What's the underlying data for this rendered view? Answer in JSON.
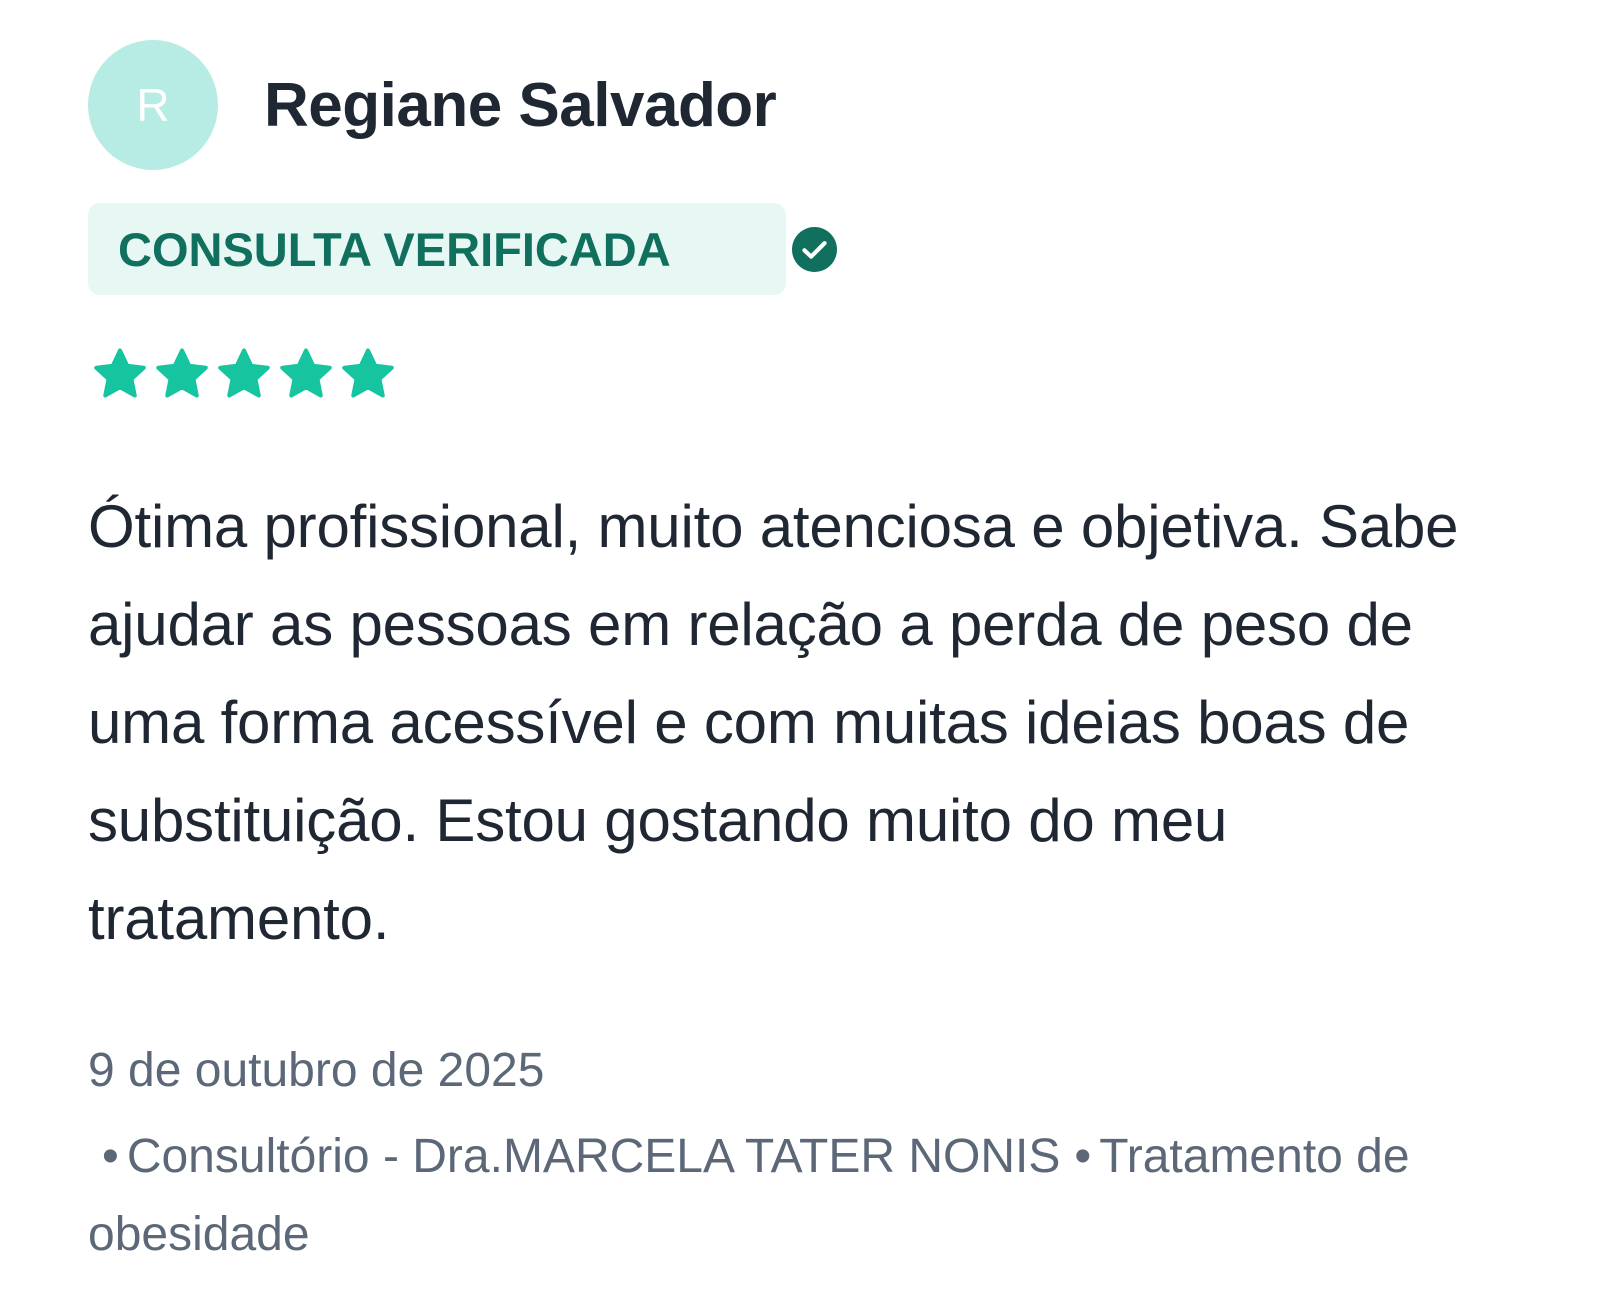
{
  "reviewer": {
    "initial": "R",
    "name": "Regiane Salvador"
  },
  "badge": {
    "label": "CONSULTA VERIFICADA",
    "icon": "check-circle-icon"
  },
  "rating": {
    "stars": 5,
    "max": 5,
    "icon": "star-icon"
  },
  "review": {
    "text": "Ótima profissional, muito atenciosa e objetiva. Sabe ajudar as pessoas em relação a perda de peso de uma forma acessível e com muitas ideias boas de substituição. Estou gostando muito do meu tratamento."
  },
  "meta": {
    "date": "9 de outubro de 2025",
    "location": "Consultório - Dra.MARCELA TATER NONIS",
    "service": "Tratamento de obesidade"
  },
  "colors": {
    "accent": "#16c4a0",
    "badge_bg": "#e6f7f4",
    "badge_text": "#10705d",
    "avatar_bg": "#b6ece3",
    "text": "#1f2733",
    "muted": "#5c6878"
  }
}
